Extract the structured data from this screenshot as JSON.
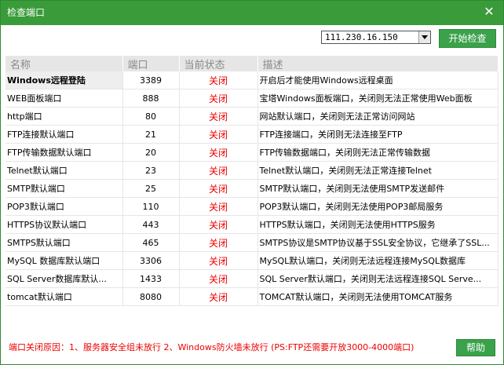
{
  "window": {
    "title": "检查端口",
    "close_glyph": "✕"
  },
  "ip_select": {
    "value": "111.230.16.150"
  },
  "start_button": "开始检查",
  "table": {
    "headers": [
      "名称",
      "端口",
      "当前状态",
      "描述"
    ],
    "rows": [
      {
        "name": "Windows远程登陆",
        "port": "3389",
        "status": "关闭",
        "desc": "开启后才能使用Windows远程桌面"
      },
      {
        "name": "WEB面板端口",
        "port": "888",
        "status": "关闭",
        "desc": "宝塔Windows面板端口，关闭则无法正常使用Web面板"
      },
      {
        "name": "http端口",
        "port": "80",
        "status": "关闭",
        "desc": "网站默认端口，关闭则无法正常访问网站"
      },
      {
        "name": "FTP连接默认端口",
        "port": "21",
        "status": "关闭",
        "desc": "FTP连接端口，关闭则无法连接至FTP"
      },
      {
        "name": "FTP传输数据默认端口",
        "port": "20",
        "status": "关闭",
        "desc": "FTP传输数据端口，关闭则无法正常传输数据"
      },
      {
        "name": "Telnet默认端口",
        "port": "23",
        "status": "关闭",
        "desc": "Telnet默认端口，关闭则无法正常连接Telnet"
      },
      {
        "name": "SMTP默认端口",
        "port": "25",
        "status": "关闭",
        "desc": "SMTP默认端口，关闭则无法使用SMTP发送邮件"
      },
      {
        "name": "POP3默认端口",
        "port": "110",
        "status": "关闭",
        "desc": "POP3默认端口，关闭则无法使用POP3邮局服务"
      },
      {
        "name": "HTTPS协议默认端口",
        "port": "443",
        "status": "关闭",
        "desc": "HTTPS默认端口，关闭则无法使用HTTPS服务"
      },
      {
        "name": "SMTPS默认端口",
        "port": "465",
        "status": "关闭",
        "desc": "SMTPS协议是SMTP协议基于SSL安全协议，它继承了SSL..."
      },
      {
        "name": "MySQL 数据库默认端口",
        "port": "3306",
        "status": "关闭",
        "desc": "MySQL默认端口，关闭则无法远程连接MySQL数据库"
      },
      {
        "name": "SQL Server数据库默认...",
        "port": "1433",
        "status": "关闭",
        "desc": "SQL Server默认端口，关闭则无法远程连接SQL Serve..."
      },
      {
        "name": "tomcat默认端口",
        "port": "8080",
        "status": "关闭",
        "desc": "TOMCAT默认端口，关闭则无法使用TOMCAT服务"
      }
    ]
  },
  "footer_note": "端口关闭原因：1、服务器安全组未放行  2、Windows防火墙未放行  (PS:FTP还需要开放3000-4000端口)",
  "help_button": "帮助",
  "colors": {
    "titlebar": "#3a9b3a",
    "button": "#3aa24a",
    "status_closed": "#ee0000",
    "header_bg": "#e6e6e6"
  }
}
